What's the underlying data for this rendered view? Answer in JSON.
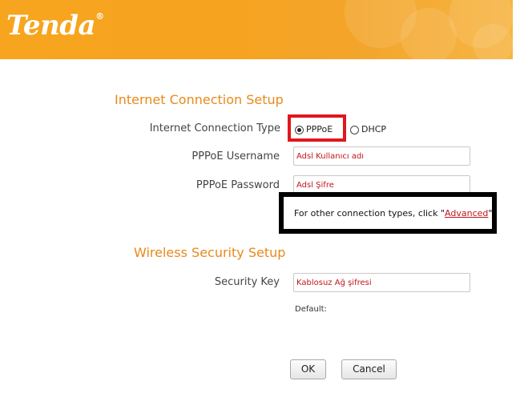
{
  "header": {
    "logo_text": "Tenda",
    "logo_mark": "®"
  },
  "internet": {
    "title": "Internet Connection Setup",
    "connection_type_label": "Internet Connection Type",
    "options": [
      "PPPoE",
      "DHCP"
    ],
    "selected": "PPPoE",
    "username_label": "PPPoE Username",
    "username_value": "Adsl Kullanıcı adı",
    "password_label": "PPPoE Password",
    "password_value": "Adsl Şifre",
    "notice_prefix": "For other connection types, click \"",
    "notice_link": "Advanced",
    "notice_suffix": "\""
  },
  "wireless": {
    "title": "Wireless Security Setup",
    "security_key_label": "Security Key",
    "security_key_value": "Kablosuz Ağ şifresi",
    "default_label": "Default:"
  },
  "buttons": {
    "ok": "OK",
    "cancel": "Cancel"
  },
  "colors": {
    "accent": "#e8891c",
    "header": "#f6a320",
    "highlight_red": "#e0171c",
    "value_red": "#c0161b"
  }
}
